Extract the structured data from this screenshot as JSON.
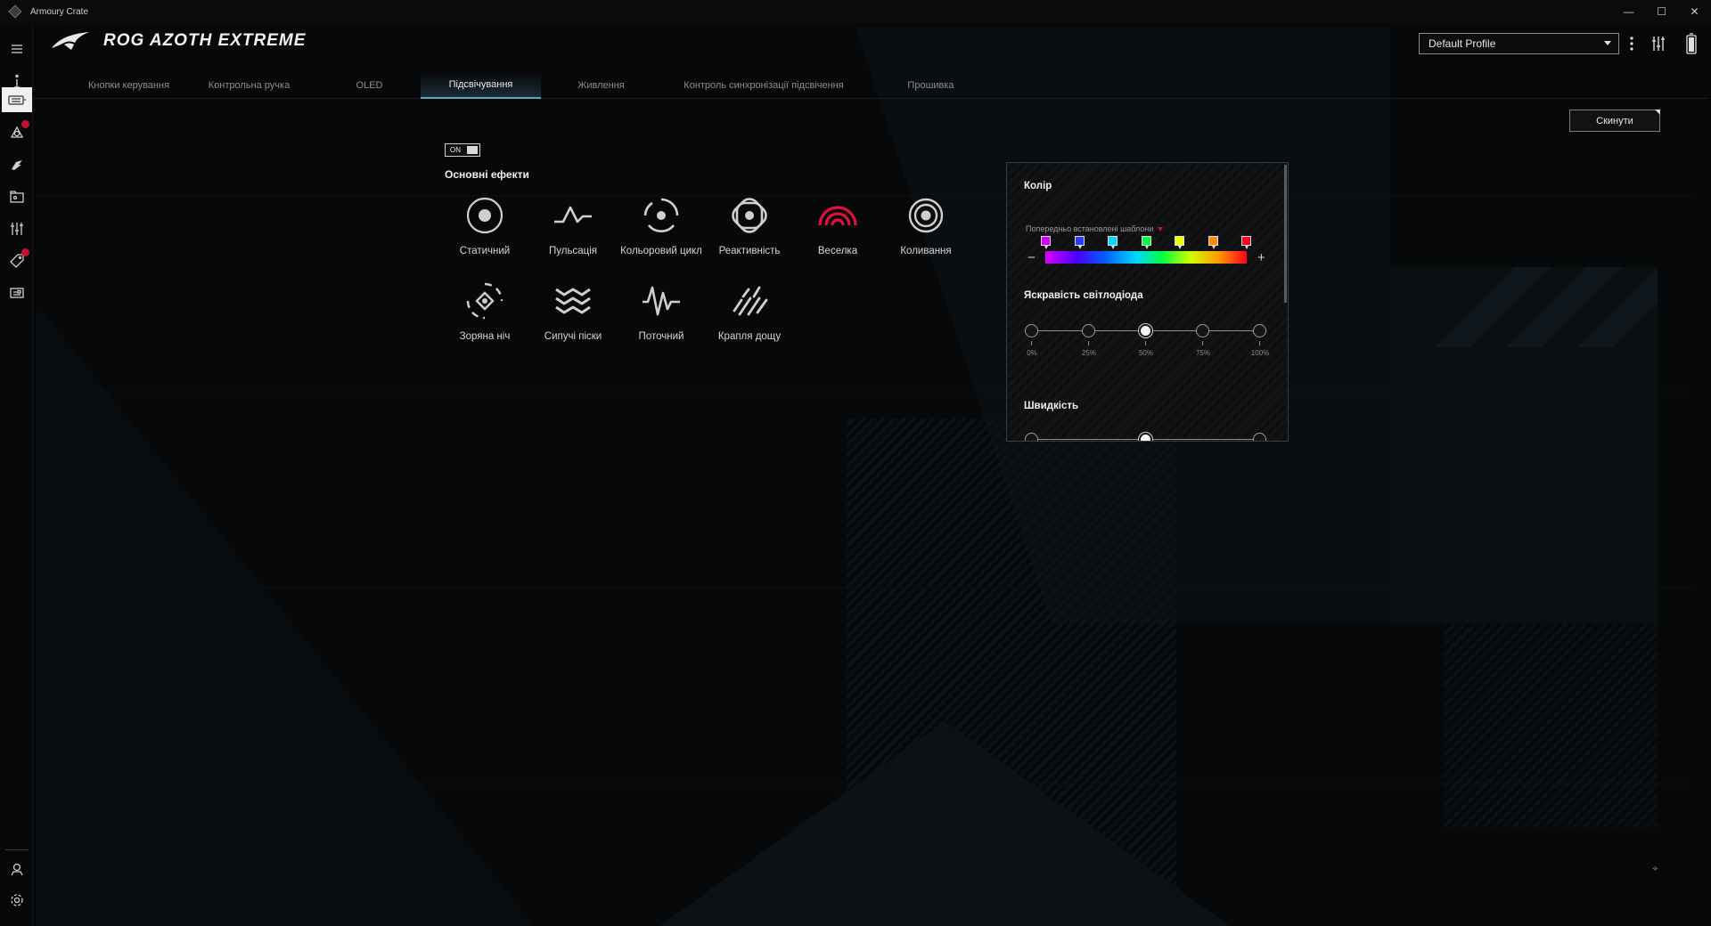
{
  "window": {
    "title": "Armoury Crate",
    "minimize": "—",
    "maximize": "☐",
    "close": "✕"
  },
  "header": {
    "device_name": "ROG AZOTH EXTREME",
    "profile": "Default Profile"
  },
  "tabs": [
    {
      "label": "Кнопки керування"
    },
    {
      "label": "Контрольна ручка"
    },
    {
      "label": "OLED"
    },
    {
      "label": "Підсвічування"
    },
    {
      "label": "Живлення"
    },
    {
      "label": "Контроль синхронізації підсвічення"
    },
    {
      "label": "Прошивка"
    }
  ],
  "active_tab": "Підсвічування",
  "actions": {
    "reset": "Скинути"
  },
  "lighting": {
    "toggle_label": "ON",
    "toggle_state": true,
    "section_title": "Основні ефекти",
    "effects": [
      {
        "label": "Статичний",
        "icon": "static-icon"
      },
      {
        "label": "Пульсація",
        "icon": "breathing-icon"
      },
      {
        "label": "Кольоровий цикл",
        "icon": "color-cycle-icon"
      },
      {
        "label": "Реактивність",
        "icon": "reactive-icon"
      },
      {
        "label": "Веселка",
        "icon": "rainbow-icon",
        "selected": true
      },
      {
        "label": "Коливання",
        "icon": "ripple-icon"
      },
      {
        "label": "Зоряна ніч",
        "icon": "starry-night-icon"
      },
      {
        "label": "Сипучі піски",
        "icon": "quicksand-icon"
      },
      {
        "label": "Поточний",
        "icon": "current-icon"
      },
      {
        "label": "Крапля дощу",
        "icon": "rain-icon"
      }
    ]
  },
  "color_panel": {
    "title": "Колір",
    "presets_label": "Попередньо встановлені шаблони",
    "preset_colors": [
      "#d400ff",
      "#2a3cff",
      "#00d8ff",
      "#00ff40",
      "#e8ff00",
      "#ff8a00",
      "#ff0020"
    ],
    "minus": "−",
    "plus": "+",
    "brightness_title": "Яскравість світлодіода",
    "brightness_steps": [
      "0%",
      "25%",
      "50%",
      "75%",
      "100%"
    ],
    "brightness_value": "50%",
    "speed_title": "Швидкість"
  },
  "colors": {
    "accent": "#63a7c4",
    "brand_red": "#c4122f",
    "bg": "#070809"
  }
}
